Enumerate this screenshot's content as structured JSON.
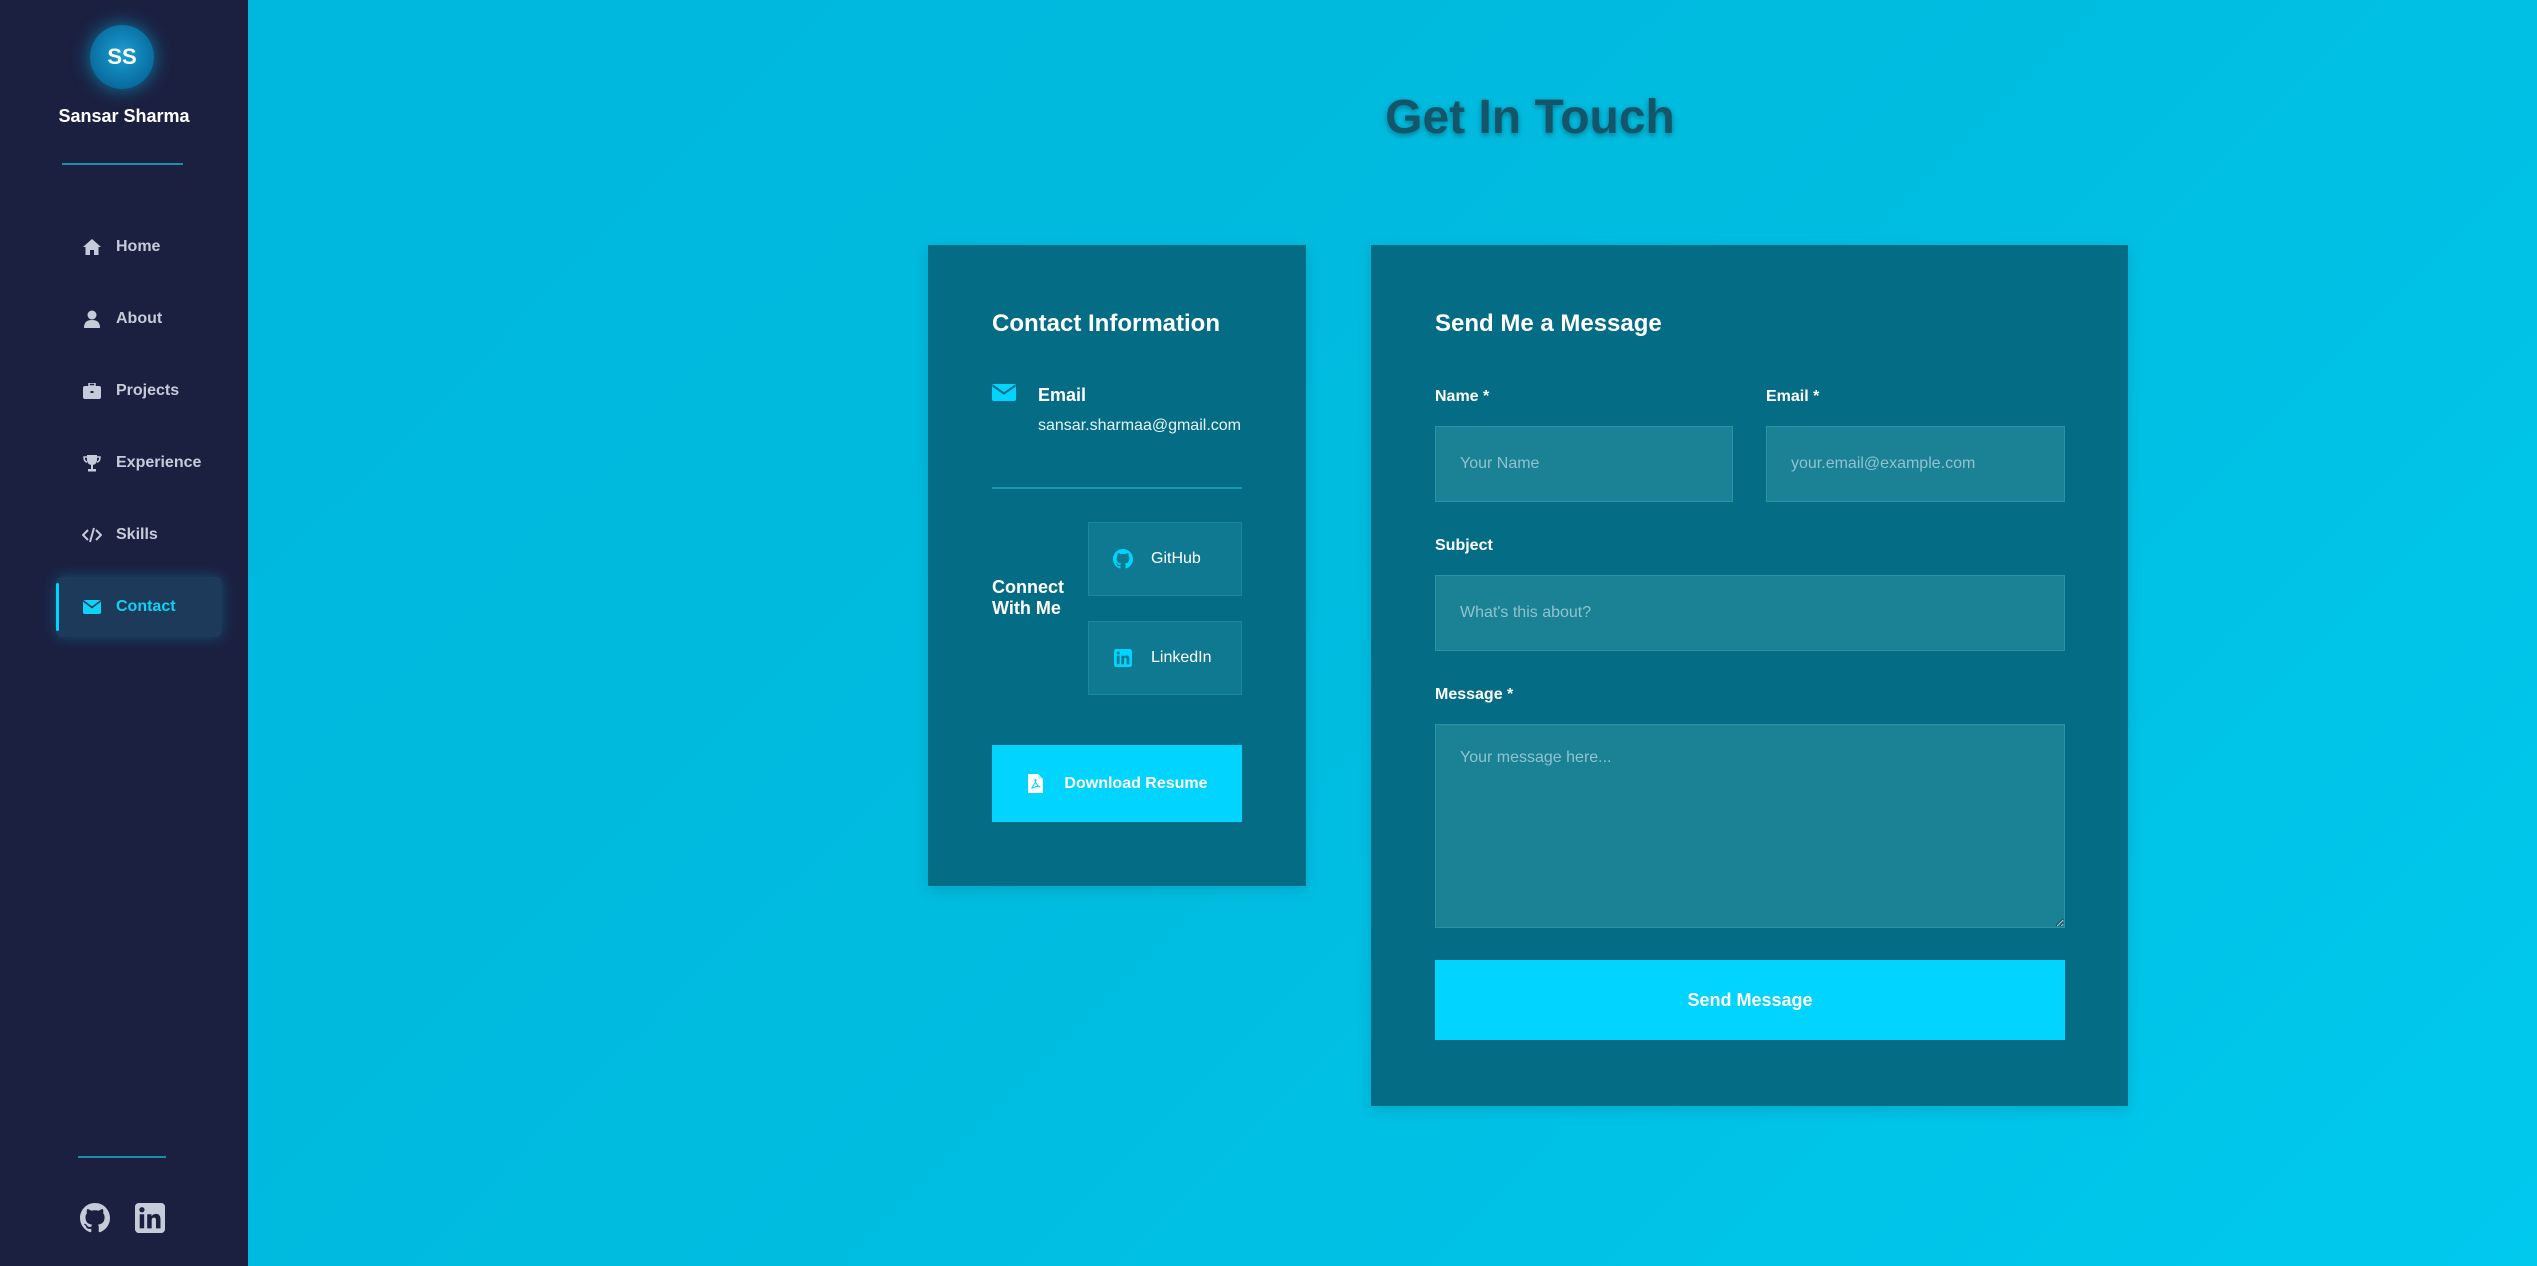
{
  "colors": {
    "sidebar_bg": "#1b2040",
    "accent": "#00d4ff",
    "card_bg": "#046c84",
    "page_bg": "#00bcdf"
  },
  "sidebar": {
    "avatar_initials": "SS",
    "name": "Sansar Sharma",
    "items": [
      {
        "label": "Home",
        "icon": "home-icon"
      },
      {
        "label": "About",
        "icon": "user-icon"
      },
      {
        "label": "Projects",
        "icon": "briefcase-icon"
      },
      {
        "label": "Experience",
        "icon": "trophy-icon"
      },
      {
        "label": "Skills",
        "icon": "code-icon"
      },
      {
        "label": "Contact",
        "icon": "envelope-icon",
        "active": true
      }
    ],
    "social_icons": [
      "github-icon",
      "linkedin-icon"
    ]
  },
  "page": {
    "title": "Get In Touch"
  },
  "contact_info": {
    "heading": "Contact Information",
    "email_label": "Email",
    "email_value": "sansar.sharmaa@gmail.com",
    "connect_label": "Connect With Me",
    "github_label": "GitHub",
    "linkedin_label": "LinkedIn",
    "resume_label": "Download Resume"
  },
  "message_form": {
    "heading": "Send Me a Message",
    "name_label": "Name *",
    "name_placeholder": "Your Name",
    "email_label": "Email *",
    "email_placeholder": "your.email@example.com",
    "subject_label": "Subject",
    "subject_placeholder": "What's this about?",
    "message_label": "Message *",
    "message_placeholder": "Your message here...",
    "send_label": "Send Message"
  }
}
